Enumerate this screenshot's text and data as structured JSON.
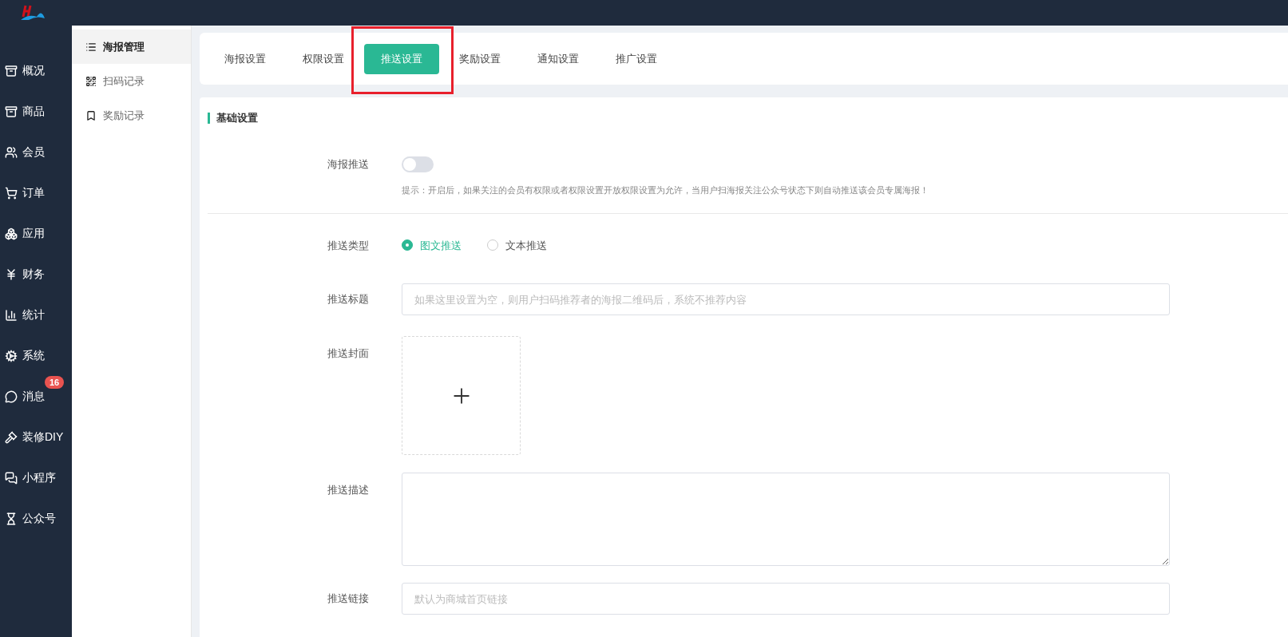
{
  "main_nav": [
    {
      "label": "概况"
    },
    {
      "label": "商品"
    },
    {
      "label": "会员"
    },
    {
      "label": "订单"
    },
    {
      "label": "应用"
    },
    {
      "label": "财务"
    },
    {
      "label": "统计"
    },
    {
      "label": "系统"
    },
    {
      "label": "消息",
      "badge": "16"
    },
    {
      "label": "装修DIY"
    },
    {
      "label": "小程序"
    },
    {
      "label": "公众号"
    }
  ],
  "sub_nav": [
    {
      "label": "海报管理",
      "selected": true
    },
    {
      "label": "扫码记录",
      "selected": false
    },
    {
      "label": "奖励记录",
      "selected": false
    }
  ],
  "tabs": [
    {
      "label": "海报设置",
      "selected": false,
      "highlighted": false
    },
    {
      "label": "权限设置",
      "selected": false,
      "highlighted": false
    },
    {
      "label": "推送设置",
      "selected": true,
      "highlighted": true
    },
    {
      "label": "奖励设置",
      "selected": false,
      "highlighted": false
    },
    {
      "label": "通知设置",
      "selected": false,
      "highlighted": false
    },
    {
      "label": "推广设置",
      "selected": false,
      "highlighted": false
    }
  ],
  "section_title": "基础设置",
  "poster_push": {
    "label": "海报推送",
    "on": false,
    "hint": "提示：开启后，如果关注的会员有权限或者权限设置开放权限设置为允许，当用户扫海报关注公众号状态下则自动推送该会员专属海报！"
  },
  "push_type": {
    "label": "推送类型",
    "options": [
      {
        "label": "图文推送",
        "selected": true
      },
      {
        "label": "文本推送",
        "selected": false
      }
    ]
  },
  "push_title": {
    "label": "推送标题",
    "placeholder": "如果这里设置为空，则用户扫码推荐者的海报二维码后，系统不推荐内容"
  },
  "push_cover": {
    "label": "推送封面"
  },
  "push_desc": {
    "label": "推送描述"
  },
  "push_link": {
    "label": "推送链接",
    "placeholder": "默认为商城首页链接"
  }
}
